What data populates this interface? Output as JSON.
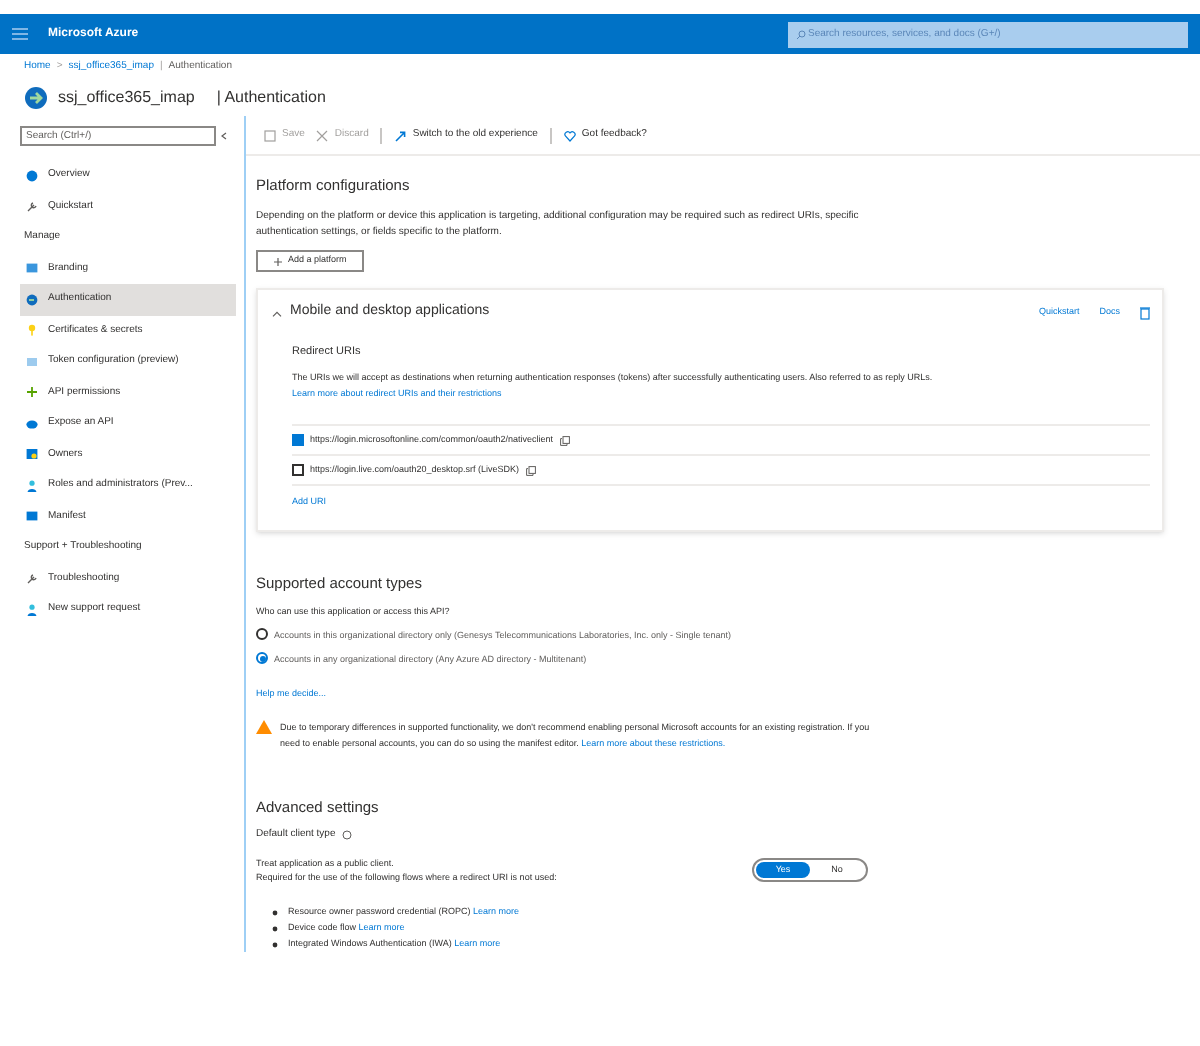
{
  "top_bar": {
    "brand": "Microsoft Azure",
    "search_placeholder": "Search resources, services, and docs (G+/)"
  },
  "breadcrumb": [
    {
      "kind": "link",
      "text": "Home"
    },
    {
      "kind": "separator",
      "text": ">"
    },
    {
      "kind": "link",
      "text": "ssj_office365_imap"
    },
    {
      "kind": "separator",
      "text": "|"
    },
    {
      "kind": "current",
      "text": "Authentication"
    }
  ],
  "header": {
    "app_name": "ssj_office365_imap",
    "page": "| Authentication"
  },
  "sidebar": {
    "search_placeholder": "Search (Ctrl+/)",
    "items": [
      {
        "kind": "item",
        "label": "Overview",
        "selected": false
      },
      {
        "kind": "item",
        "label": "Quickstart",
        "selected": false
      },
      {
        "kind": "section",
        "label": "Manage"
      },
      {
        "kind": "item",
        "label": "Branding",
        "selected": false
      },
      {
        "kind": "item",
        "label": "Authentication",
        "selected": true
      },
      {
        "kind": "item",
        "label": "Certificates & secrets",
        "selected": false
      },
      {
        "kind": "item",
        "label": "Token configuration (preview)",
        "selected": false
      },
      {
        "kind": "item",
        "label": "API permissions",
        "selected": false
      },
      {
        "kind": "item",
        "label": "Expose an API",
        "selected": false
      },
      {
        "kind": "item",
        "label": "Owners",
        "selected": false
      },
      {
        "kind": "item",
        "label": "Roles and administrators (Prev...",
        "selected": false
      },
      {
        "kind": "item",
        "label": "Manifest",
        "selected": false
      },
      {
        "kind": "section",
        "label": "Support + Troubleshooting"
      },
      {
        "kind": "item",
        "label": "Troubleshooting",
        "selected": false
      },
      {
        "kind": "item",
        "label": "New support request",
        "selected": false
      }
    ]
  },
  "toolbar": [
    {
      "label": "Save",
      "disabled": true
    },
    {
      "label": "Discard",
      "disabled": true
    },
    {
      "label": "Switch to the old experience",
      "disabled": false
    },
    {
      "label": "Got feedback?",
      "disabled": false
    }
  ],
  "platform": {
    "title": "Platform configurations",
    "description": "Depending on the platform or device this application is targeting, additional configuration may be required such as redirect URIs, specific authentication settings, or fields specific to the platform.",
    "add_button": "Add a platform",
    "card": {
      "title": "Mobile and desktop applications",
      "expanded": true,
      "links": [
        "Quickstart",
        "Docs"
      ],
      "section": "Redirect URIs",
      "description": "The URIs we will accept as destinations when returning authentication responses (tokens) after successfully authenticating users. Also referred to as reply URLs.",
      "description_link": "Learn more about redirect URIs and their restrictions",
      "uris": [
        {
          "value": "https://login.microsoftonline.com/common/oauth2/nativeclient",
          "checked": true
        },
        {
          "value": "https://login.live.com/oauth20_desktop.srf (LiveSDK)",
          "checked": false
        }
      ],
      "add_uri": "Add URI"
    }
  },
  "accounts": {
    "title": "Supported account types",
    "question": "Who can use this application or access this API?",
    "options": [
      {
        "label": "Accounts in this organizational directory only (Genesys Telecommunications Laboratories, Inc. only - Single tenant)",
        "selected": false
      },
      {
        "label": "Accounts in any organizational directory (Any Azure AD directory - Multitenant)",
        "selected": true
      }
    ],
    "help": "Help me decide...",
    "warning": "Due to temporary differences in supported functionality, we don't recommend enabling personal Microsoft accounts for an existing registration. If you need to enable personal accounts, you can do so using the manifest editor.",
    "warning_link": "Learn more about these restrictions."
  },
  "advanced": {
    "title": "Advanced settings",
    "client_type": "Default client type",
    "treat_label": "Treat application as a public client.",
    "treat_hint": "Required for the use of the following flows where a redirect URI is not used:",
    "toggle": [
      {
        "label": "Yes",
        "selected": true
      },
      {
        "label": "No",
        "selected": false
      }
    ],
    "flows": [
      {
        "text": "Resource owner password credential (ROPC)",
        "link": "Learn more"
      },
      {
        "text": "Device code flow",
        "link": "Learn more"
      },
      {
        "text": "Integrated Windows Authentication (IWA)",
        "link": "Learn more"
      }
    ]
  }
}
